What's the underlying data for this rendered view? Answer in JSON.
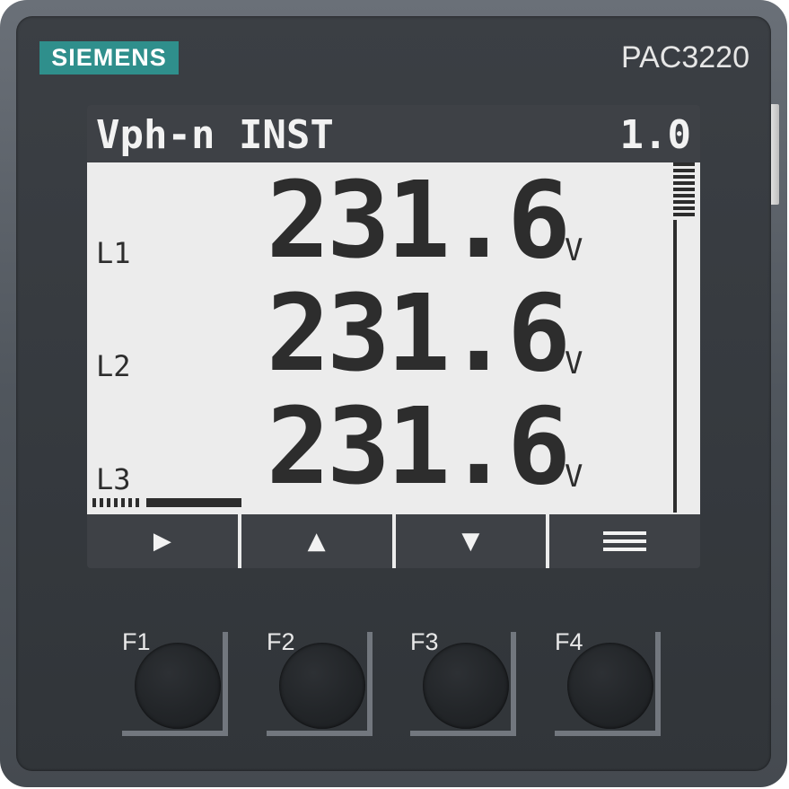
{
  "device": {
    "brand": "SIEMENS",
    "model": "PAC3220"
  },
  "display": {
    "title": "Vph-n INST",
    "page": "1.0",
    "rows": [
      {
        "phase": "L1",
        "value": "231.6",
        "unit": "V"
      },
      {
        "phase": "L2",
        "value": "231.6",
        "unit": "V"
      },
      {
        "phase": "L3",
        "value": "231.6",
        "unit": "V"
      }
    ],
    "softkeys": [
      {
        "icon": "play-right-icon",
        "glyph": "▶"
      },
      {
        "icon": "arrow-up-icon",
        "glyph": "▲"
      },
      {
        "icon": "arrow-down-icon",
        "glyph": "▼"
      },
      {
        "icon": "menu-icon",
        "glyph": ""
      }
    ]
  },
  "function_keys": [
    {
      "label": "F1"
    },
    {
      "label": "F2"
    },
    {
      "label": "F3"
    },
    {
      "label": "F4"
    }
  ],
  "colors": {
    "brand_bg": "#2f8f8c",
    "lcd_bg": "#ececec",
    "lcd_ink": "#2d2d2d"
  }
}
